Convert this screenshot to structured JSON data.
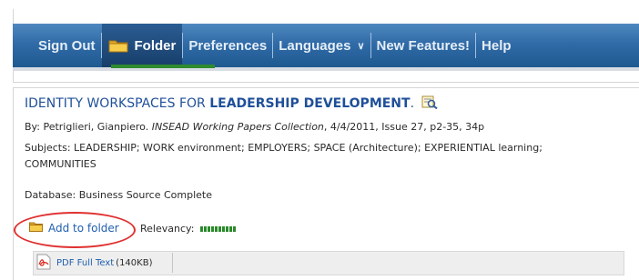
{
  "nav": {
    "items": [
      {
        "label": "Sign Out"
      },
      {
        "label": "Folder",
        "icon": "folder-icon",
        "active": true
      },
      {
        "label": "Preferences"
      },
      {
        "label": "Languages",
        "icon": "chevron-down-icon"
      },
      {
        "label": "New Features!"
      },
      {
        "label": "Help"
      }
    ],
    "colors": {
      "bar": "#2f6aa6",
      "active": "#173e6a",
      "active_underline": "#2e8b2e"
    }
  },
  "record": {
    "title_plain": "IDENTITY WORKSPACES FOR ",
    "title_bold": "LEADERSHIP DEVELOPMENT",
    "title_end": ".",
    "title_icon": "preview-magnifier-icon",
    "byline_prefix": "By: Petriglieri, Gianpiero. ",
    "source": "INSEAD Working Papers Collection",
    "source_details": ", 4/4/2011, Issue 27, p2-35, 34p",
    "subjects_line1": "Subjects: LEADERSHIP; WORK environment; EMPLOYERS; SPACE (Architecture); EXPERIENTIAL learning;",
    "subjects_line2": "COMMUNITIES",
    "database": "Database: Business Source Complete",
    "add_to_folder": "Add to folder",
    "relevancy_label": "Relevancy:",
    "relevancy_level": 1.0,
    "fulltext_label": "PDF Full Text",
    "fulltext_size": "(140KB)"
  }
}
